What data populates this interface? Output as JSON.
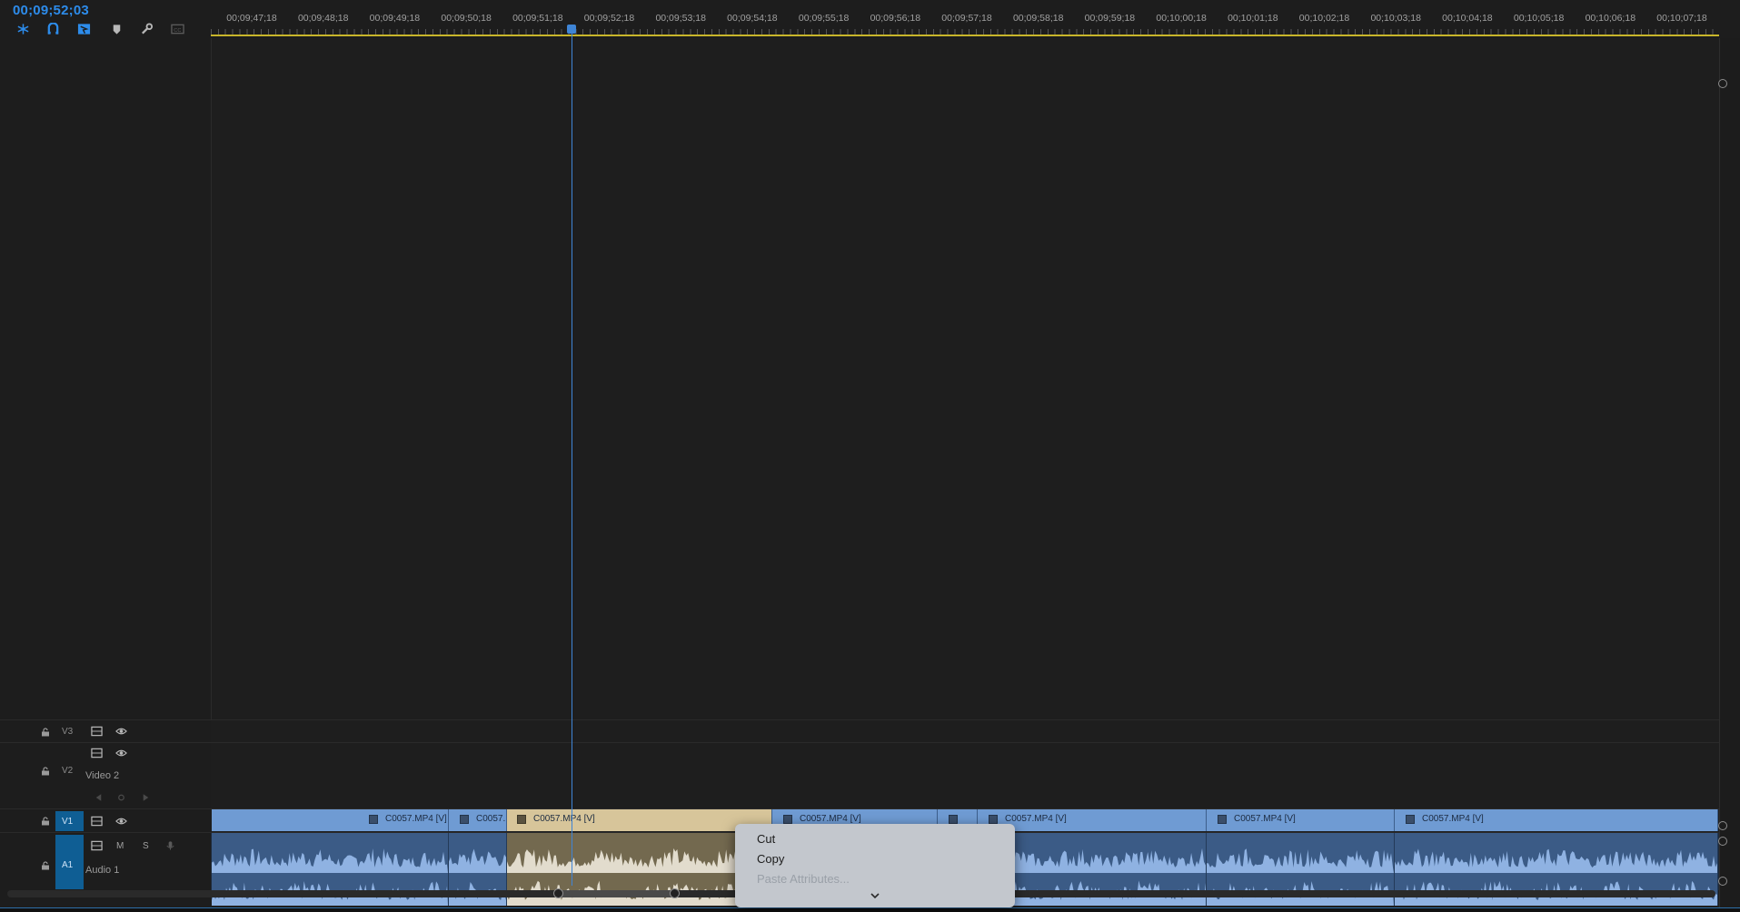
{
  "timeline": {
    "timecode": "00;09;52;03",
    "ruler_ticks": [
      "00;09;47;18",
      "00;09;48;18",
      "00;09;49;18",
      "00;09;50;18",
      "00;09;51;18",
      "00;09;52;18",
      "00;09;53;18",
      "00;09;54;18",
      "00;09;55;18",
      "00;09;56;18",
      "00;09;57;18",
      "00;09;58;18",
      "00;09;59;18",
      "00;10;00;18",
      "00;10;01;18",
      "00;10;02;18",
      "00;10;03;18",
      "00;10;04;18",
      "00;10;05;18",
      "00;10;06;18",
      "00;10;07;18"
    ],
    "tools": [
      "snap-icon",
      "linked-selection-icon",
      "add-marker-icon",
      "marker-icon",
      "wrench-icon",
      "captions-icon"
    ]
  },
  "tracks": {
    "v3": {
      "id": "V3"
    },
    "v2": {
      "id": "V2",
      "name": "Video 2"
    },
    "v1": {
      "id": "V1"
    },
    "a1": {
      "id": "A1",
      "name": "Audio 1",
      "mute": "M",
      "solo": "S"
    }
  },
  "clips": {
    "video": [
      {
        "label": "C0057.MP4 [V]"
      },
      {
        "label": "C0057."
      },
      {
        "label": "C0057.MP4 [V]",
        "selected": true
      },
      {
        "label": "C0057.MP4 [V]"
      },
      {
        "label": ""
      },
      {
        "label": "C0057.MP4 [V]"
      },
      {
        "label": "C0057.MP4 [V]"
      },
      {
        "label": "C0057.MP4 [V]"
      }
    ]
  },
  "context_menu": {
    "items": [
      {
        "label": "Cut",
        "enabled": true
      },
      {
        "label": "Copy",
        "enabled": true
      },
      {
        "label": "Paste Attributes...",
        "enabled": false
      }
    ],
    "more_icon": "chevron-down-icon"
  },
  "colors": {
    "accent": "#2d8ceb",
    "video_clip": "#6f9bd3",
    "selected_clip": "#d7c59a",
    "audio_clip": "#3b5b86",
    "work_area": "#c8b52a"
  }
}
